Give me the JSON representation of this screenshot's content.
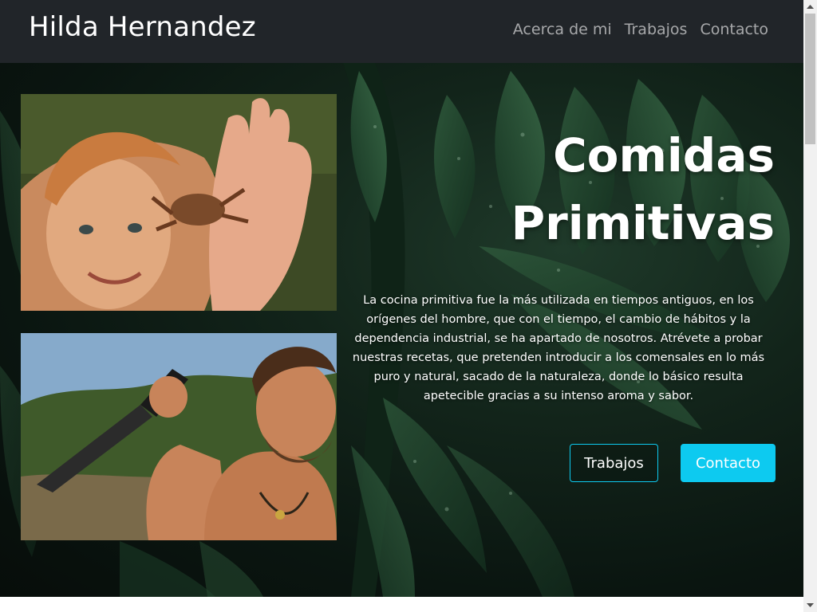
{
  "navbar": {
    "brand": "Hilda Hernandez",
    "links": [
      "Acerca de mi",
      "Trabajos",
      "Contacto"
    ]
  },
  "hero": {
    "title_line1": "Comidas",
    "title_line2": "Primitivas",
    "description": "La cocina primitiva fue la más utilizada en tiempos antiguos, en los orígenes del hombre, que con el tiempo, el cambio de hábitos y la dependencia industrial, se ha apartado de nosotros. Atrévete a probar nuestras recetas, que pretenden introducir a los comensales en lo más puro y natural, sacado de la naturaleza, donde lo básico resulta apetecible gracias a su intenso aroma y sabor.",
    "buttons": {
      "outline_label": "Trabajos",
      "solid_label": "Contacto"
    }
  },
  "colors": {
    "navbar_bg": "#212529",
    "accent": "#0dcaf0",
    "hero_bg": "#0a1510"
  },
  "icons": [
    "scroll-up-arrow-icon",
    "scroll-down-arrow-icon"
  ]
}
